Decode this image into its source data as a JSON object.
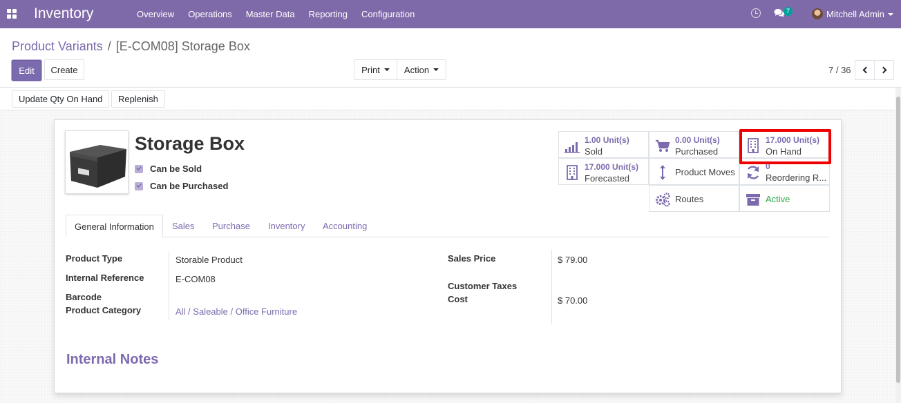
{
  "navbar": {
    "app_name": "Inventory",
    "menu": [
      "Overview",
      "Operations",
      "Master Data",
      "Reporting",
      "Configuration"
    ],
    "chat_badge": "7",
    "user_name": "Mitchell Admin"
  },
  "breadcrumb": {
    "parent": "Product Variants",
    "separator": "/",
    "current": "[E-COM08] Storage Box"
  },
  "control_panel": {
    "edit_label": "Edit",
    "create_label": "Create",
    "print_label": "Print",
    "action_label": "Action",
    "pager": "7 / 36"
  },
  "statusbar": {
    "update_qty_label": "Update Qty On Hand",
    "replenish_label": "Replenish"
  },
  "product": {
    "name": "Storage Box",
    "can_be_sold_label": "Can be Sold",
    "can_be_purchased_label": "Can be Purchased"
  },
  "smart_buttons": {
    "sold": {
      "value": "1.00",
      "unit": "Unit(s)",
      "label": "Sold",
      "icon": "bar-chart-icon"
    },
    "purchased": {
      "value": "0.00",
      "unit": "Unit(s)",
      "label": "Purchased",
      "icon": "cart-icon"
    },
    "on_hand": {
      "value": "17.000",
      "unit": "Unit(s)",
      "label": "On Hand",
      "icon": "building-icon"
    },
    "forecasted": {
      "value": "17.000",
      "unit": "Unit(s)",
      "label": "Forecasted",
      "icon": "building-icon"
    },
    "product_moves": {
      "label": "Product Moves",
      "icon": "arrows-vertical-icon"
    },
    "reordering": {
      "value": "0",
      "label": "Reordering R...",
      "icon": "refresh-icon"
    },
    "routes": {
      "label": "Routes",
      "icon": "cogs-icon"
    },
    "active": {
      "label": "Active",
      "icon": "archive-icon",
      "color": "#28a745"
    }
  },
  "tabs": [
    "General Information",
    "Sales",
    "Purchase",
    "Inventory",
    "Accounting"
  ],
  "general_info": {
    "product_type_label": "Product Type",
    "product_type_value": "Storable Product",
    "internal_ref_label": "Internal Reference",
    "internal_ref_value": "E-COM08",
    "barcode_label": "Barcode",
    "product_category_label": "Product Category",
    "product_category_value": "All / Saleable / Office Furniture",
    "sales_price_label": "Sales Price",
    "sales_price_value": "$ 79.00",
    "customer_taxes_label": "Customer Taxes",
    "cost_label": "Cost",
    "cost_value": "$ 70.00"
  },
  "notes": {
    "title": "Internal Notes"
  },
  "colors": {
    "brand": "#7f6aa9",
    "link": "#7c6aae",
    "highlight": "#e00000",
    "active": "#28a745"
  }
}
